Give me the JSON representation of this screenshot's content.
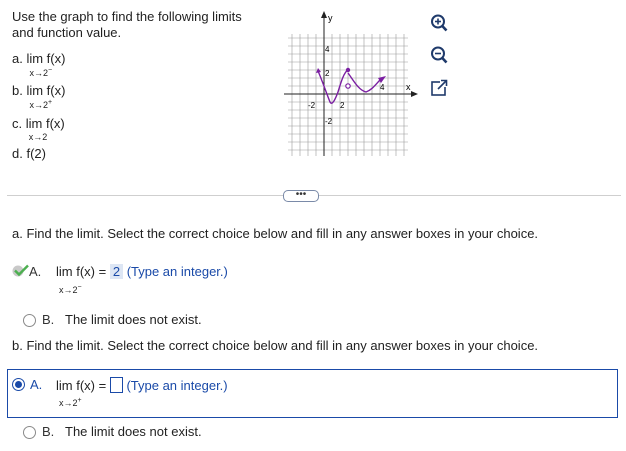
{
  "prompt": {
    "line1": "Use the graph to find the following limits",
    "line2": "and function value."
  },
  "parts": [
    {
      "letter": "a.",
      "expr": "lim f(x)",
      "sub": "x→2",
      "sup": "−"
    },
    {
      "letter": "b.",
      "expr": "lim f(x)",
      "sub": "x→2",
      "sup": "+"
    },
    {
      "letter": "c.",
      "expr": "lim f(x)",
      "sub": "x→2",
      "sup": ""
    },
    {
      "letter": "d.",
      "expr": "f(2)"
    }
  ],
  "graph": {
    "axis_x_label": "x",
    "axis_y_label": "y",
    "tick_labels": {
      "y_top": "4",
      "y_mid": "2",
      "y_neg": "-2",
      "x_neg": "-2",
      "x_2": "2",
      "x_4": "4"
    },
    "curve_color": "#7b1fa2",
    "axis_color": "#222222",
    "grid_color": "#9a9a9a"
  },
  "tools": [
    "zoom-in-icon",
    "zoom-out-icon",
    "expand-icon"
  ],
  "more_label": "•••",
  "question_a": {
    "text": "a. Find the limit. Select the correct choice below and fill in any answer boxes in your choice.",
    "choice_a": {
      "letter": "A.",
      "expr": "lim f(x) =",
      "sub": "x→2",
      "sup": "−",
      "answer": "2",
      "hint": "(Type an integer.)"
    },
    "choice_b": {
      "letter": "B.",
      "text": "The limit does not exist."
    }
  },
  "question_b": {
    "text": "b. Find the limit. Select the correct choice below and fill in any answer boxes in your choice.",
    "choice_a": {
      "letter": "A.",
      "expr": "lim f(x) =",
      "sub": "x→2",
      "sup": "+",
      "answer": "",
      "hint": "(Type an integer.)"
    },
    "choice_b": {
      "letter": "B.",
      "text": "The limit does not exist."
    }
  },
  "colors": {
    "accent": "#1a4aa8",
    "check": "#4caf50",
    "answer_bg": "#dde6f4"
  }
}
